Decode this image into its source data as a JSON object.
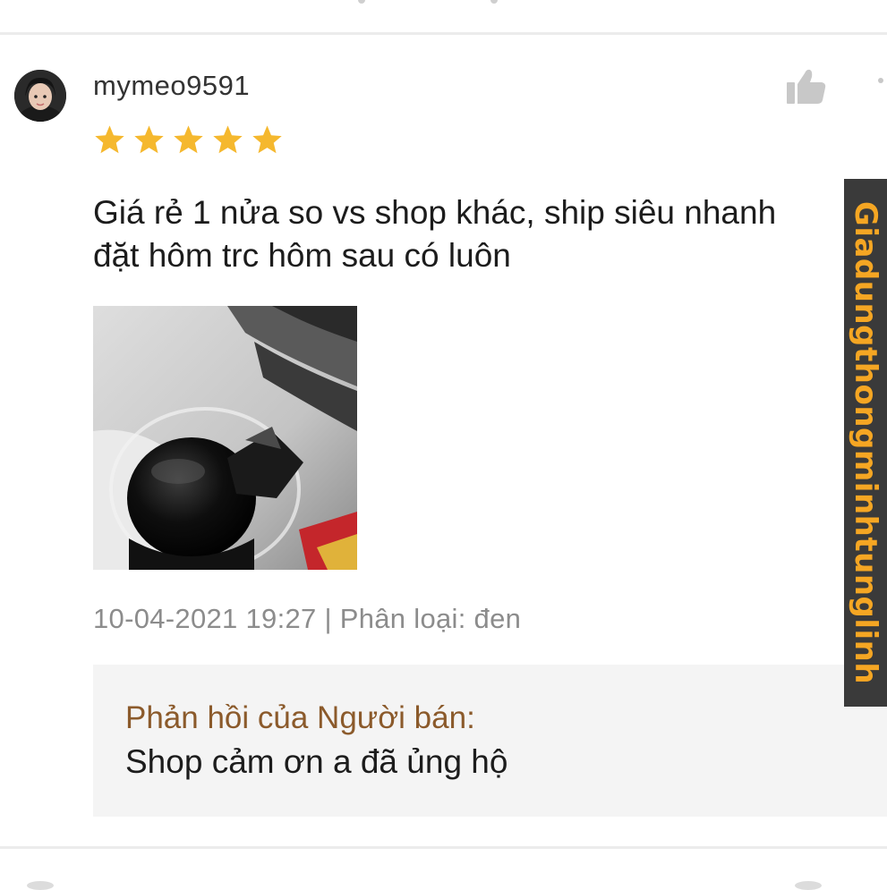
{
  "review": {
    "username": "mymeo9591",
    "rating": 5,
    "text_lines": [
      "Giá rẻ 1 nửa so vs shop khác, ship siêu nhanh",
      "đặt hôm trc hôm sau có luôn"
    ],
    "meta": "10-04-2021 19:27 | Phân loại: đen"
  },
  "seller_reply": {
    "title": "Phản hồi của Người bán:",
    "text": "Shop cảm ơn a đã ủng hộ"
  },
  "watermark": {
    "text": "Giadungthongminhtunglinh"
  },
  "icons": {
    "like": "thumbs-up-icon",
    "more": "more-icon",
    "star": "star-icon"
  },
  "colors": {
    "star": "#f5b82e",
    "reply_title": "#8b5a2b",
    "watermark_text": "#f5a623",
    "watermark_bg": "#3a3a3a",
    "reply_bg": "#f4f4f4",
    "meta_text": "#8c8c8c"
  }
}
